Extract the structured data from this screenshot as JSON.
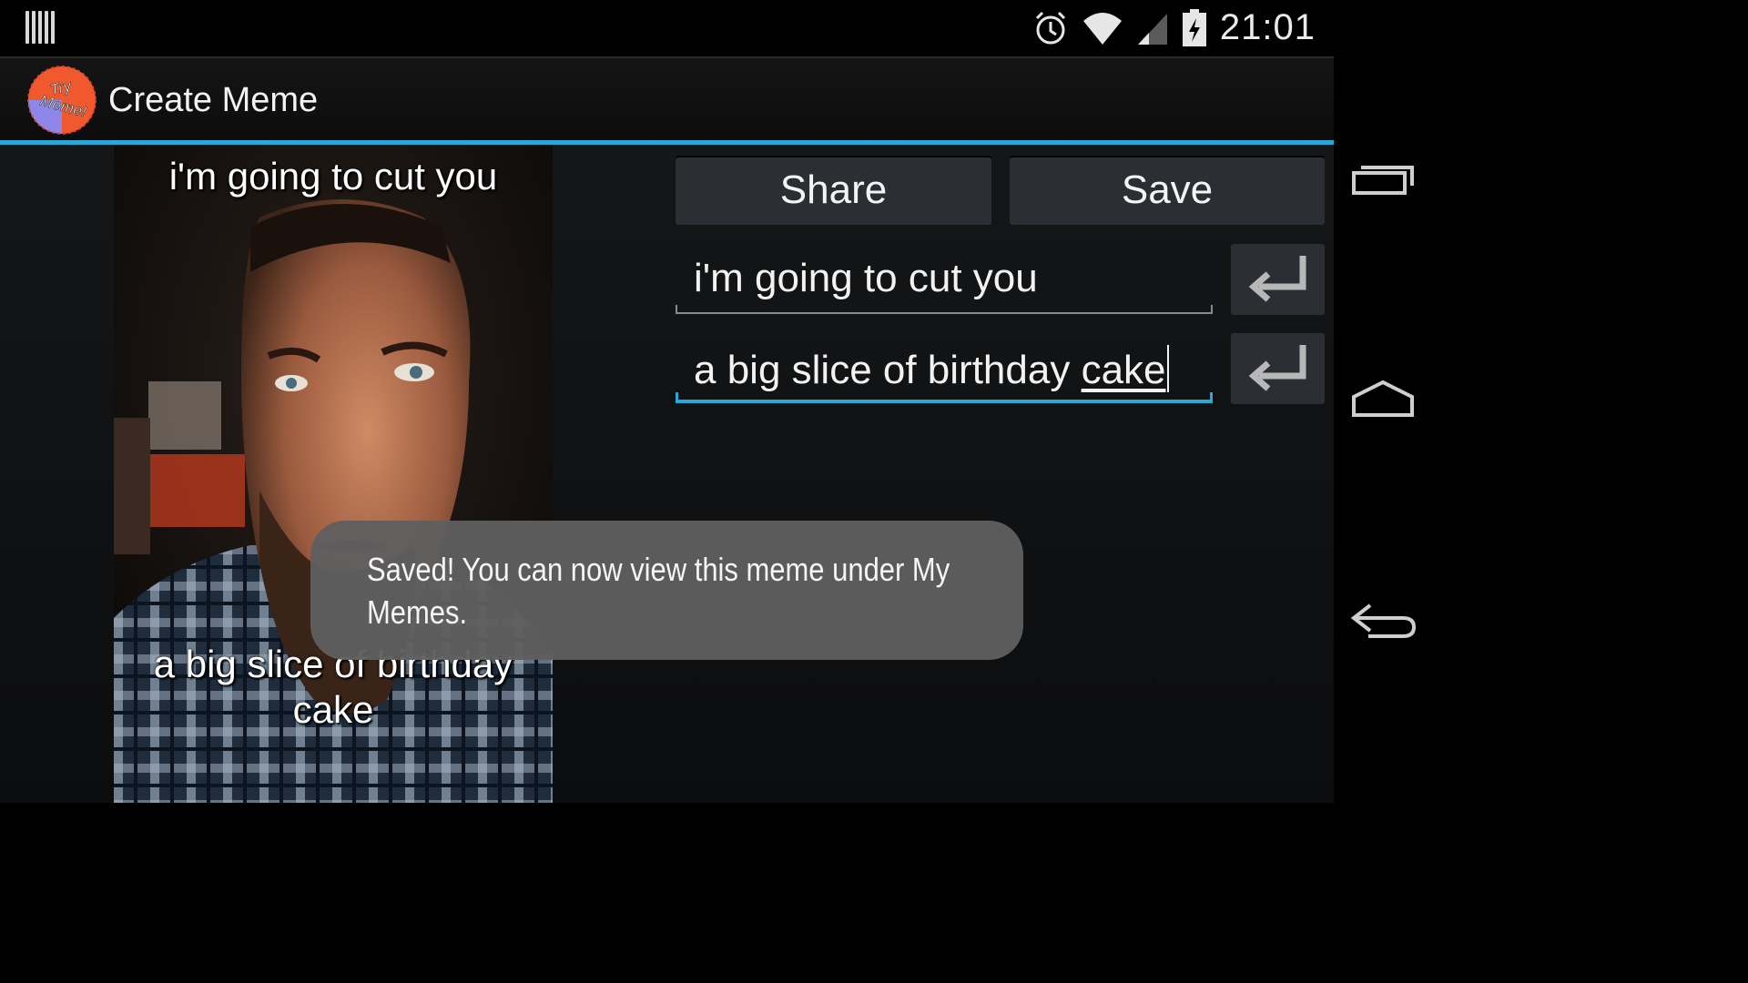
{
  "status_bar": {
    "time": "21:01",
    "icons": [
      "notification-icon",
      "alarm-icon",
      "wifi-icon",
      "signal-icon",
      "battery-charging-icon"
    ]
  },
  "action_bar": {
    "app_icon_text_1": "Try",
    "app_icon_text_2": "Meme!",
    "title": "Create Meme",
    "accent_color": "#2aa8d6"
  },
  "meme": {
    "top_caption": "i'm going to cut you",
    "bottom_caption": "a big slice of birthday cake"
  },
  "buttons": {
    "share_label": "Share",
    "save_label": "Save"
  },
  "fields": {
    "top_text": "i'm going to cut you",
    "bottom_text_plain": "a big slice of birthday ",
    "bottom_text_underlined": "cake"
  },
  "toast": {
    "message": "Saved! You can now view this meme under My Memes."
  },
  "nav_bar": {
    "icons": [
      "recent-apps-icon",
      "home-icon",
      "back-icon"
    ]
  }
}
